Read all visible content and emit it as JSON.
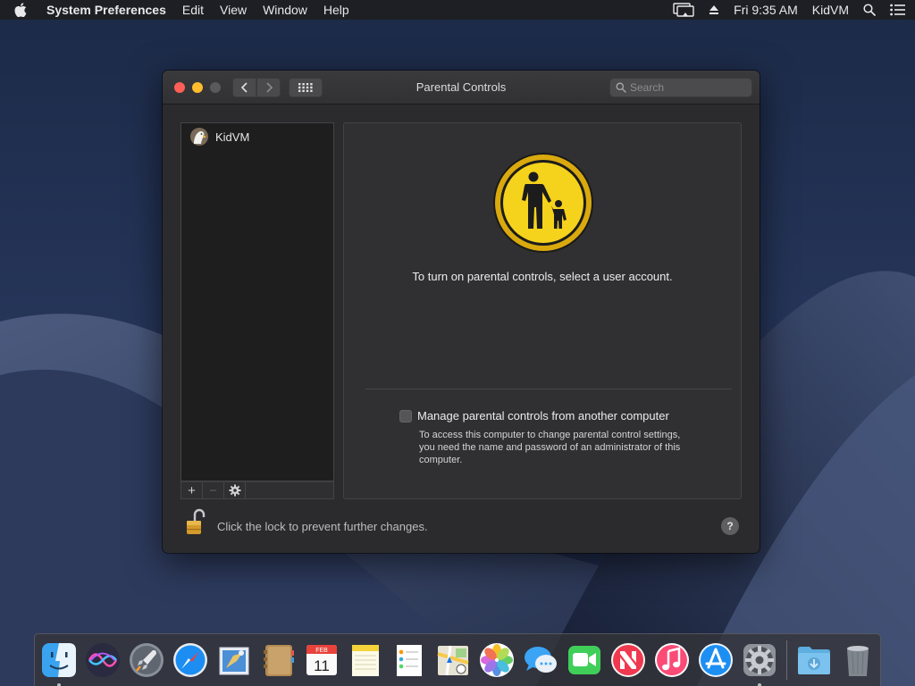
{
  "menubar": {
    "app_name": "System Preferences",
    "menus": [
      "Edit",
      "View",
      "Window",
      "Help"
    ],
    "clock": "Fri 9:35 AM",
    "user": "KidVM",
    "icons": [
      "apple-icon",
      "display-mirroring-icon",
      "eject-icon",
      "spotlight-search-icon",
      "notification-center-icon"
    ]
  },
  "window": {
    "title": "Parental Controls",
    "search_placeholder": "Search",
    "users": [
      {
        "name": "KidVM",
        "avatar": "eagle-avatar"
      }
    ],
    "list_toolbar": {
      "add": "+",
      "remove": "−",
      "action_icon": "gear-icon",
      "remove_enabled": false
    },
    "prompt": "To turn on parental controls, select a user account.",
    "remote_manage_label": "Manage parental controls from another computer",
    "remote_manage_checked": false,
    "remote_manage_description": "To access this computer to change parental control settings, you need the name and password of an administrator of this computer.",
    "lock_text": "Click the lock to prevent further changes.",
    "lock_state": "unlocked",
    "help": "?"
  },
  "calendar_icon": {
    "month": "FEB",
    "day": "11"
  },
  "dock": {
    "items": [
      {
        "name": "finder",
        "running": true
      },
      {
        "name": "siri",
        "running": false
      },
      {
        "name": "launchpad",
        "running": false
      },
      {
        "name": "safari",
        "running": false
      },
      {
        "name": "mail",
        "running": false
      },
      {
        "name": "contacts",
        "running": false
      },
      {
        "name": "calendar",
        "running": false
      },
      {
        "name": "notes",
        "running": false
      },
      {
        "name": "reminders",
        "running": false
      },
      {
        "name": "maps",
        "running": false
      },
      {
        "name": "photos",
        "running": false
      },
      {
        "name": "messages",
        "running": false
      },
      {
        "name": "facetime",
        "running": false
      },
      {
        "name": "news",
        "running": false
      },
      {
        "name": "itunes",
        "running": false
      },
      {
        "name": "app-store",
        "running": false
      },
      {
        "name": "system-preferences",
        "running": true
      },
      {
        "name": "downloads",
        "running": false
      },
      {
        "name": "trash",
        "running": false
      }
    ]
  },
  "colors": {
    "traffic_close": "#fe5f57",
    "traffic_minimize": "#febc2e",
    "parental_icon_yellow": "#f5d21c",
    "window_bg": "#2b2b2d"
  }
}
